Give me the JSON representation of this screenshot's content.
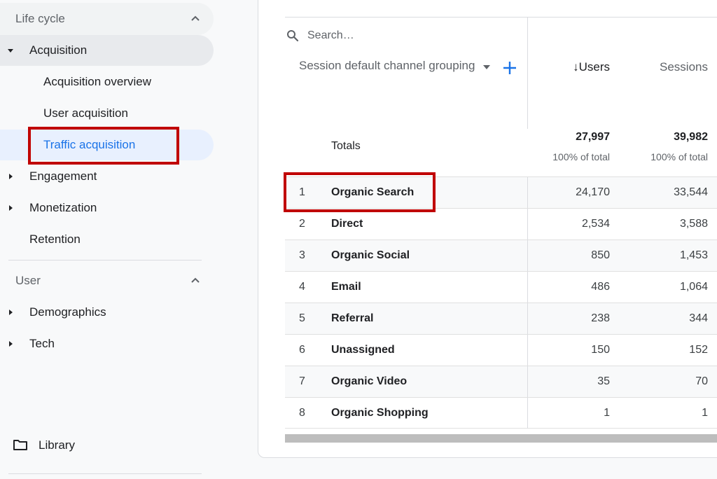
{
  "sidebar": {
    "lifecycle_label": "Life cycle",
    "items": [
      {
        "label": "Acquisition"
      },
      {
        "label": "Acquisition overview"
      },
      {
        "label": "User acquisition"
      },
      {
        "label": "Traffic acquisition"
      },
      {
        "label": "Engagement"
      },
      {
        "label": "Monetization"
      },
      {
        "label": "Retention"
      }
    ],
    "user_label": "User",
    "user_items": [
      {
        "label": "Demographics"
      },
      {
        "label": "Tech"
      }
    ],
    "library_label": "Library"
  },
  "table": {
    "search_placeholder": "Search…",
    "dimension_header": "Session default channel grouping",
    "columns": {
      "users": "↓Users",
      "sessions": "Sessions"
    },
    "totals": {
      "label": "Totals",
      "users": "27,997",
      "users_pct": "100% of total",
      "sessions": "39,982",
      "sessions_pct": "100% of total"
    },
    "rows": [
      {
        "index": "1",
        "channel": "Organic Search",
        "users": "24,170",
        "sessions": "33,544"
      },
      {
        "index": "2",
        "channel": "Direct",
        "users": "2,534",
        "sessions": "3,588"
      },
      {
        "index": "3",
        "channel": "Organic Social",
        "users": "850",
        "sessions": "1,453"
      },
      {
        "index": "4",
        "channel": "Email",
        "users": "486",
        "sessions": "1,064"
      },
      {
        "index": "5",
        "channel": "Referral",
        "users": "238",
        "sessions": "344"
      },
      {
        "index": "6",
        "channel": "Unassigned",
        "users": "150",
        "sessions": "152"
      },
      {
        "index": "7",
        "channel": "Organic Video",
        "users": "35",
        "sessions": "70"
      },
      {
        "index": "8",
        "channel": "Organic Shopping",
        "users": "1",
        "sessions": "1"
      }
    ]
  },
  "colors": {
    "accent": "#1a73e8",
    "highlight_box": "#c00000",
    "active_bg": "#e8f0fe"
  },
  "icons": [
    "chevron-up-icon",
    "caret-down-icon",
    "caret-right-icon",
    "search-icon",
    "dropdown-arrow-icon",
    "plus-icon",
    "folder-icon"
  ]
}
